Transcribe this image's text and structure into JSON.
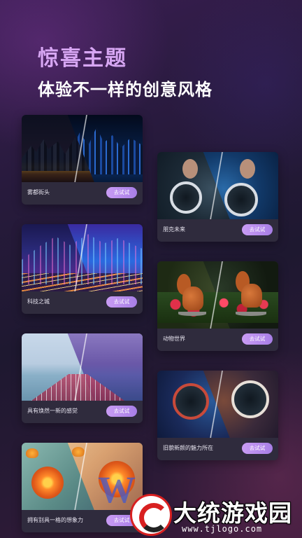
{
  "header": {
    "title": "惊喜主题",
    "subtitle": "体验不一样的创意风格"
  },
  "accent_color": "#d7a6f3",
  "button_gradient": [
    "#c99cf4",
    "#a77ee6"
  ],
  "themes": [
    {
      "caption": "雾都街头",
      "button": "去试试"
    },
    {
      "caption": "朋克未来",
      "button": "去试试"
    },
    {
      "caption": "科技之城",
      "button": "去试试"
    },
    {
      "caption": "动物世界",
      "button": "去试试"
    },
    {
      "caption": "具有焕然一新的感觉",
      "button": "去试试"
    },
    {
      "caption": "旧貌新颜的魅力所在",
      "button": "去试试"
    },
    {
      "caption": "拥有别具一格的想象力",
      "button": "去试试"
    }
  ],
  "watermark": {
    "brand": "大统游戏园",
    "url": "www.tjlogo.com"
  }
}
